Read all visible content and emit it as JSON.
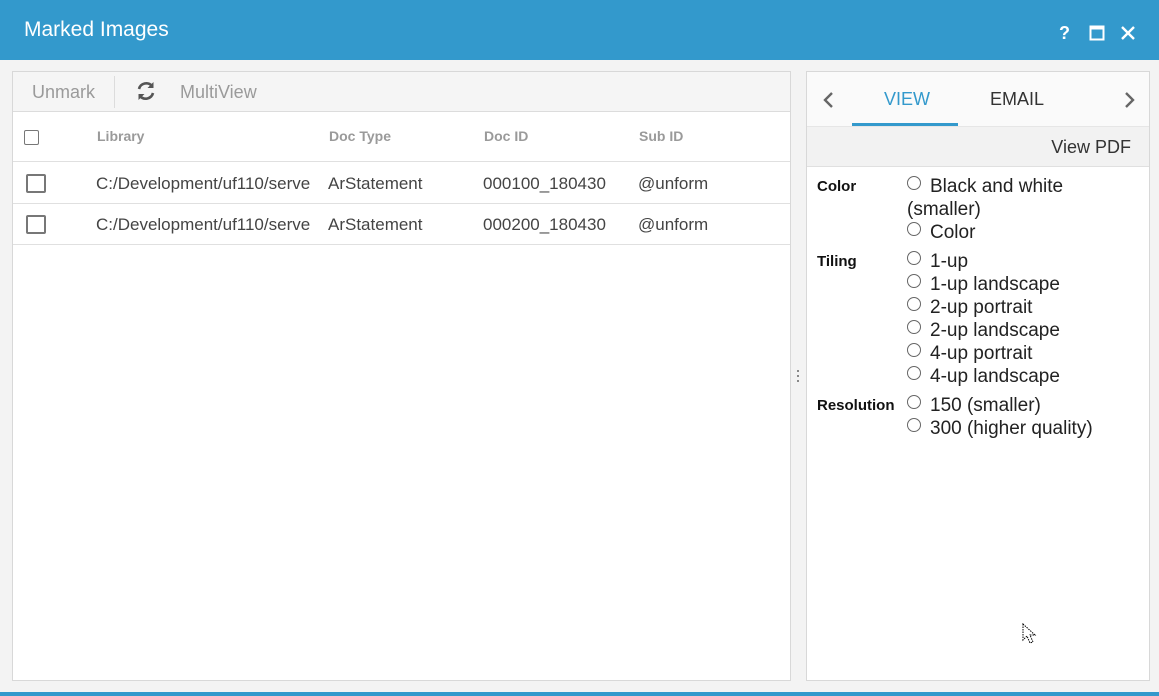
{
  "window": {
    "title": "Marked Images",
    "help_icon": "question-mark-icon",
    "maximize_icon": "maximize-icon",
    "close_icon": "close-icon"
  },
  "toolbar": {
    "unmark_label": "Unmark",
    "refresh_icon": "refresh-icon",
    "multiview_label": "MultiView"
  },
  "grid": {
    "columns": [
      "Library",
      "Doc Type",
      "Doc ID",
      "Sub ID"
    ],
    "rows": [
      {
        "library": "C:/Development/uf110/serve",
        "doc_type": "ArStatement",
        "doc_id": "000100_180430",
        "sub_id": "@unform"
      },
      {
        "library": "C:/Development/uf110/serve",
        "doc_type": "ArStatement",
        "doc_id": "000200_180430",
        "sub_id": "@unform"
      }
    ]
  },
  "side": {
    "tabs": [
      "VIEW",
      "EMAIL"
    ],
    "active_tab": "VIEW",
    "view_pdf_label": "View PDF",
    "options": {
      "color_label": "Color",
      "color_bw_line1": "Black and white",
      "color_bw_line2": "(smaller)",
      "color_color": "Color",
      "tiling_label": "Tiling",
      "tiling_choices": [
        "1-up",
        "1-up landscape",
        "2-up portrait",
        "2-up landscape",
        "4-up portrait",
        "4-up landscape"
      ],
      "resolution_label": "Resolution",
      "resolution_choices": [
        "150 (smaller)",
        "300 (higher quality)"
      ]
    }
  },
  "colors": {
    "accent": "#3399cc",
    "toolbar_text": "#9a9a9a"
  }
}
